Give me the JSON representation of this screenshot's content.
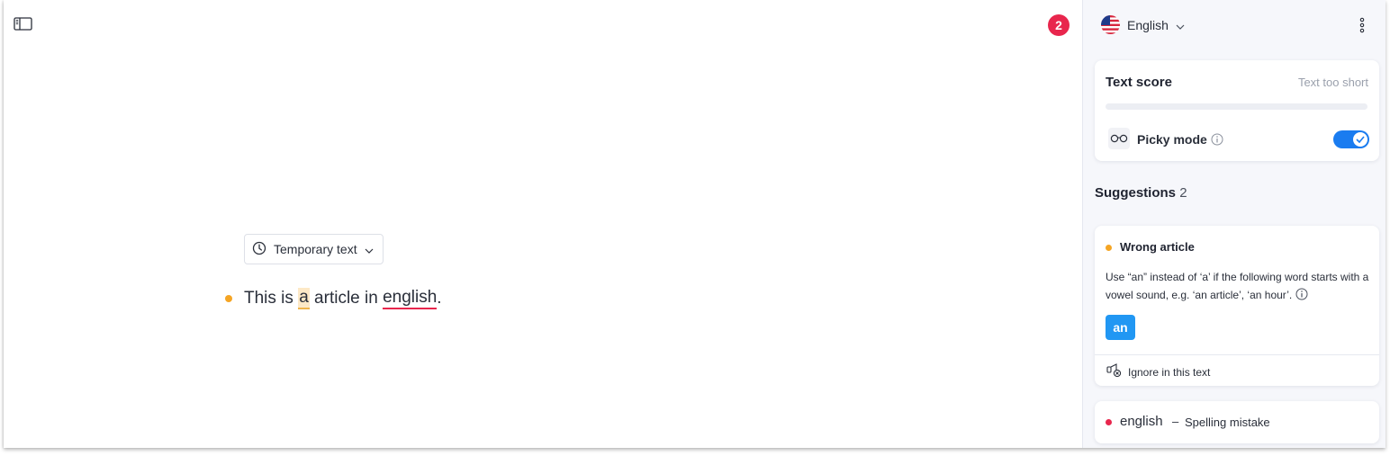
{
  "editor": {
    "issue_count": "2",
    "document_type": {
      "label": "Temporary text",
      "icon": "clock-icon"
    },
    "text": {
      "segments": [
        {
          "text": "This is ",
          "mark": null
        },
        {
          "text": "a",
          "mark": "article"
        },
        {
          "text": " article in ",
          "mark": null
        },
        {
          "text": "english",
          "mark": "spelling"
        },
        {
          "text": ".",
          "mark": null
        }
      ]
    }
  },
  "sidebar": {
    "language": {
      "label": "English",
      "icon": "us-flag-icon"
    },
    "text_score": {
      "title": "Text score",
      "status": "Text too short",
      "progress": 0
    },
    "picky_mode": {
      "label": "Picky mode",
      "enabled": true
    },
    "suggestions": {
      "title": "Suggestions",
      "count": "2",
      "items": [
        {
          "title": "Wrong article",
          "severity_color": "#f5a524",
          "description": "Use “an” instead of ‘a’ if the following word starts with a vowel sound, e.g. ‘an article’, ‘an hour’.",
          "replacement": "an",
          "ignore_label": "Ignore in this text"
        },
        {
          "word": "english",
          "separator": "–",
          "type": "Spelling mistake",
          "severity_color": "#e8264d"
        }
      ]
    }
  },
  "colors": {
    "accent": "#1a7cf0",
    "badge": "#e8264d",
    "warning": "#f5a524"
  }
}
